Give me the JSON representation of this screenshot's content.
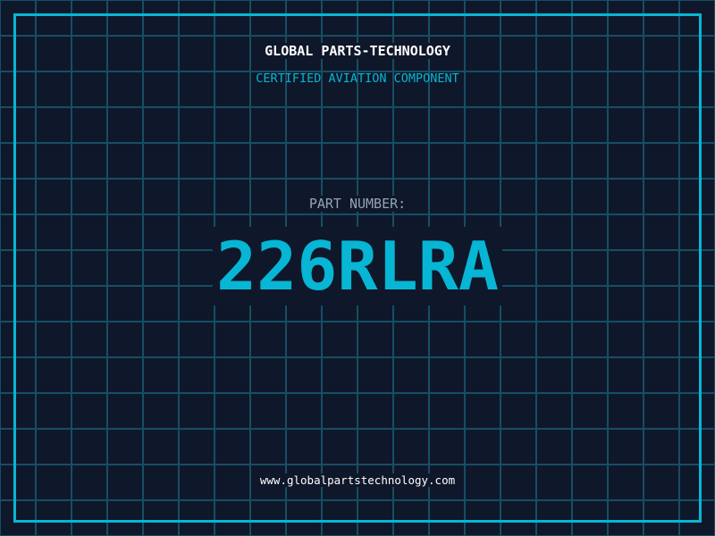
{
  "header": {
    "company": "GLOBAL PARTS-TECHNOLOGY",
    "subtitle": "CERTIFIED AVIATION COMPONENT"
  },
  "part": {
    "label": "PART NUMBER:",
    "number": "226RLRA"
  },
  "footer": {
    "url": "www.globalpartstechnology.com"
  },
  "colors": {
    "background": "#0f172a",
    "grid": "#164e63",
    "accent": "#06b6d4",
    "label": "#94a3b8"
  }
}
